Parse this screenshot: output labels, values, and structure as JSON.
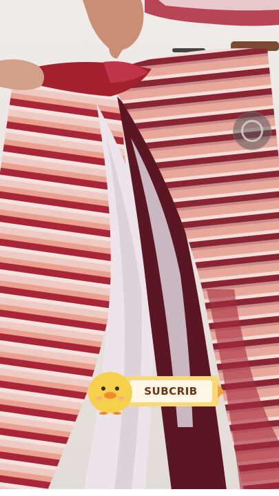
{
  "scene": {
    "icon": "video-frame"
  },
  "overlay": {
    "subscribe_label": "SUBCRIB",
    "mascot_icon": "chick-icon",
    "control_icon": "circle-control-icon"
  },
  "colors": {
    "meat_red": "#8e1f2a",
    "fat": "#efd6d0",
    "badge_yellow": "#f7d97a",
    "badge_text": "#6b3412"
  }
}
